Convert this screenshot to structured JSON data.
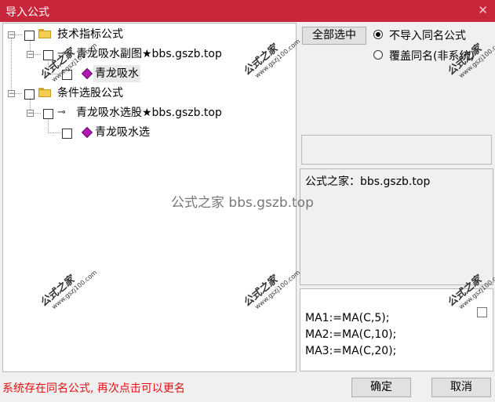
{
  "window": {
    "title": "导入公式",
    "close_glyph": "✕"
  },
  "tree": {
    "nodes": [
      {
        "label": "技术指标公式",
        "icon": "folder-icon",
        "checked": false,
        "expander": "−"
      },
      {
        "label": "青龙吸水副图★bbs.gszb.top",
        "icon": "key-icon",
        "checked": false,
        "expander": "−"
      },
      {
        "label": "青龙吸水",
        "icon": "formula-gem-icon",
        "checked": false,
        "selected": true
      },
      {
        "label": "条件选股公式",
        "icon": "folder-icon",
        "checked": false,
        "expander": "−"
      },
      {
        "label": "青龙吸水选股★bbs.gszb.top",
        "icon": "key-icon",
        "checked": false,
        "expander": "−"
      },
      {
        "label": "青龙吸水选",
        "icon": "formula-gem-icon",
        "checked": false
      }
    ]
  },
  "options": {
    "select_all_label": "全部选中",
    "radio_no_import_label": "不导入同名公式",
    "radio_overwrite_label": "覆盖同名(非系统)",
    "radio_selected": "no_import"
  },
  "info_text": "公式之家：bbs.gszb.top",
  "formula_lines": [
    "MA1:=MA(C,5);",
    "MA2:=MA(C,10);",
    "MA3:=MA(C,20);"
  ],
  "status_text": "系统存在同名公式, 再次点击可以更名",
  "buttons": {
    "ok_label": "确定",
    "cancel_label": "取消"
  },
  "watermarks": {
    "logo_text": "公式之家",
    "logo_url": "www.gszj100.com",
    "center_text": "公式之家 bbs.gszb.top"
  },
  "colors": {
    "titlebar": "#c8263a",
    "status_text": "#e01010",
    "gem": "#b219b2"
  }
}
